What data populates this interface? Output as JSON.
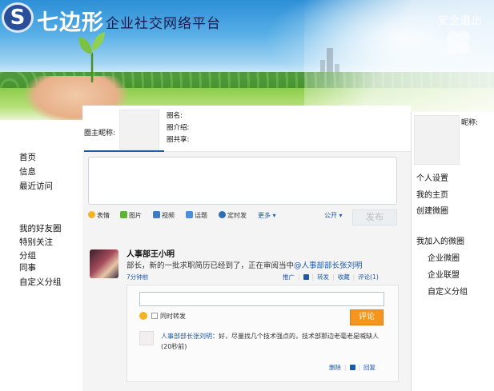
{
  "header": {
    "logo_letter": "S",
    "logo_main": "七边形",
    "logo_sub": "企业社交网络平台",
    "logout": "安全退出"
  },
  "left_nav": {
    "group1": [
      "首页",
      "信息",
      "最近访问"
    ],
    "group2": [
      "我的好友圈",
      "特别关注",
      "分组",
      "同事",
      "自定义分组"
    ]
  },
  "circle": {
    "owner_label": "圈主昵称:",
    "name_label": "圈名:",
    "intro_label": "圈介绍:",
    "share_label": "圈共享:"
  },
  "composer": {
    "tools": [
      "表情",
      "图片",
      "视频",
      "话题",
      "定时发",
      "更多"
    ],
    "visibility": "公开",
    "publish": "发布"
  },
  "post": {
    "author": "人事部王小明",
    "body_text": "部长，新的一批求职简历已经到了，正在审阅当中",
    "body_mention": "@人事部部长张刘明",
    "time": "7分钟前",
    "actions": [
      "推广",
      "转发",
      "收藏",
      "评论(1)"
    ]
  },
  "comment_box": {
    "repost_label": "同时转发",
    "submit": "评论"
  },
  "reply": {
    "author": "人事部部长张刘明",
    "text": "：好，尽量找几个技术强点的，技术部那边老毫老是喊缺人",
    "time": "(20秒前)",
    "actions": [
      "删除",
      "回复"
    ]
  },
  "right_panel": {
    "nickname_label": "昵称:",
    "menu": [
      "个人设置",
      "我的主页",
      "创建微圈"
    ],
    "joined_title": "我加入的微圈",
    "joined": [
      "企业微圈",
      "企业联盟",
      "自定义分组"
    ]
  },
  "colors": {
    "accent": "#1e5aa8",
    "comment_button": "#f7941d",
    "logo_circle": "#2a4f9a"
  },
  "icons": [
    "logo-s-icon",
    "sprout-icon",
    "clover-icon",
    "emoji-icon",
    "picture-icon",
    "video-icon",
    "topic-icon",
    "timer-icon",
    "thumb-up-icon"
  ]
}
